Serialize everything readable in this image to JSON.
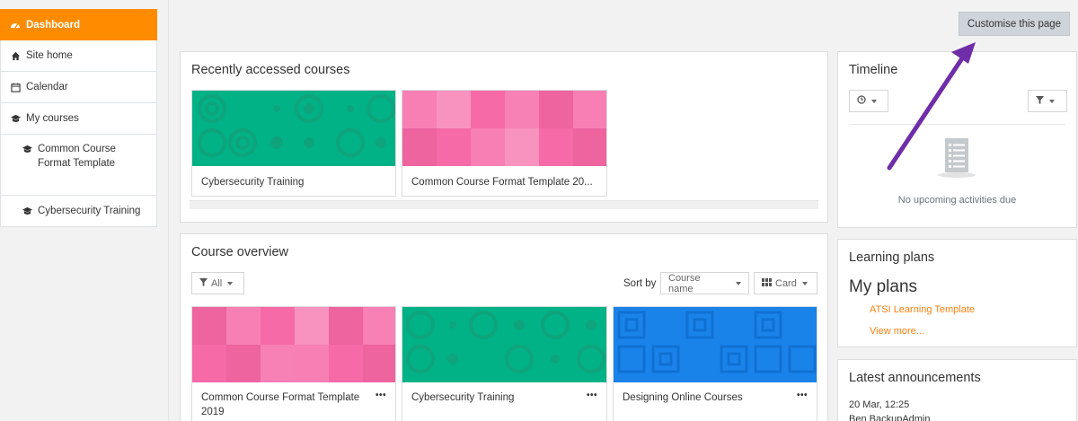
{
  "sidebar": {
    "items": [
      {
        "label": "Dashboard",
        "icon": "dashboard-icon",
        "active": true
      },
      {
        "label": "Site home",
        "icon": "home-icon"
      },
      {
        "label": "Calendar",
        "icon": "calendar-icon"
      },
      {
        "label": "My courses",
        "icon": "graduation-cap-icon"
      },
      {
        "label": "Common Course Format Template",
        "icon": "graduation-cap-icon"
      },
      {
        "label": "Cybersecurity Training",
        "icon": "graduation-cap-icon"
      }
    ]
  },
  "header": {
    "customise_label": "Customise this page"
  },
  "recent": {
    "title": "Recently accessed courses",
    "courses": [
      {
        "name": "Cybersecurity Training",
        "pattern": "green-circles",
        "color": "#00b286"
      },
      {
        "name": "Common Course Format Template 20...",
        "pattern": "pink-squares",
        "color": "#f96aa7"
      }
    ]
  },
  "overview": {
    "title": "Course overview",
    "filter_label": "All",
    "sort_label": "Sort by",
    "sort_value": "Course name",
    "view_value": "Card",
    "courses": [
      {
        "name": "Common Course Format Template 2019",
        "pattern": "pink-squares",
        "color": "#f96aa7"
      },
      {
        "name": "Cybersecurity Training",
        "pattern": "green-circles",
        "color": "#00b286"
      },
      {
        "name": "Designing Online Courses",
        "pattern": "blue-squares",
        "color": "#1a83ea"
      }
    ]
  },
  "timeline": {
    "title": "Timeline",
    "empty_text": "No upcoming activities due"
  },
  "plans": {
    "title": "Learning plans",
    "subtitle": "My plans",
    "plan_link": "ATSI Learning Template",
    "view_more": "View more..."
  },
  "announcements": {
    "title": "Latest announcements",
    "date": "20 Mar, 12:25",
    "author": "Ben BackupAdmin"
  },
  "colors": {
    "accent": "#ff8c00",
    "link": "#f98012",
    "arrow": "#6f2da8"
  }
}
